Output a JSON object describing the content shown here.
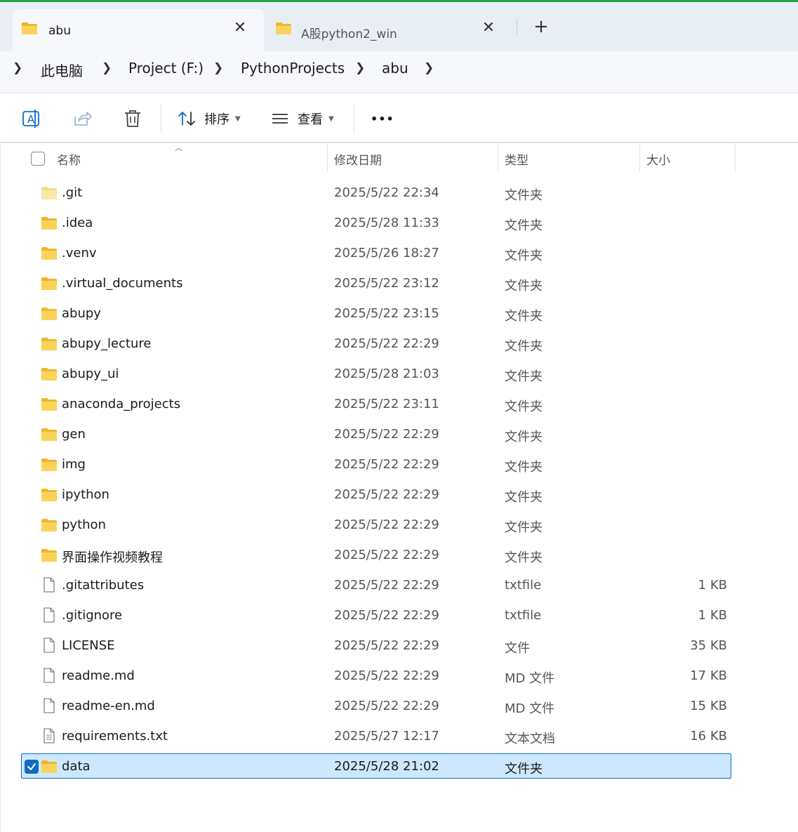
{
  "tabs": [
    {
      "label": "abu",
      "active": true,
      "icon": "folder-icon"
    },
    {
      "label": "A股python2_win",
      "active": false,
      "icon": "folder-icon"
    }
  ],
  "new_tab_label": "+",
  "close_glyph": "✕",
  "breadcrumb": [
    "此电脑",
    "Project (F:)",
    "PythonProjects",
    "abu"
  ],
  "toolbar": {
    "sort_label": "排序",
    "view_label": "查看",
    "more_label": "•••"
  },
  "columns": {
    "name": "名称",
    "date": "修改日期",
    "type": "类型",
    "size": "大小"
  },
  "files": [
    {
      "name": ".git",
      "date": "2025/5/22 22:34",
      "type": "文件夹",
      "size": "",
      "kind": "folder-light"
    },
    {
      "name": ".idea",
      "date": "2025/5/28 11:33",
      "type": "文件夹",
      "size": "",
      "kind": "folder"
    },
    {
      "name": ".venv",
      "date": "2025/5/26 18:27",
      "type": "文件夹",
      "size": "",
      "kind": "folder"
    },
    {
      "name": ".virtual_documents",
      "date": "2025/5/22 23:12",
      "type": "文件夹",
      "size": "",
      "kind": "folder"
    },
    {
      "name": "abupy",
      "date": "2025/5/22 23:15",
      "type": "文件夹",
      "size": "",
      "kind": "folder"
    },
    {
      "name": "abupy_lecture",
      "date": "2025/5/22 22:29",
      "type": "文件夹",
      "size": "",
      "kind": "folder"
    },
    {
      "name": "abupy_ui",
      "date": "2025/5/28 21:03",
      "type": "文件夹",
      "size": "",
      "kind": "folder"
    },
    {
      "name": "anaconda_projects",
      "date": "2025/5/22 23:11",
      "type": "文件夹",
      "size": "",
      "kind": "folder"
    },
    {
      "name": "gen",
      "date": "2025/5/22 22:29",
      "type": "文件夹",
      "size": "",
      "kind": "folder"
    },
    {
      "name": "img",
      "date": "2025/5/22 22:29",
      "type": "文件夹",
      "size": "",
      "kind": "folder"
    },
    {
      "name": "ipython",
      "date": "2025/5/22 22:29",
      "type": "文件夹",
      "size": "",
      "kind": "folder"
    },
    {
      "name": "python",
      "date": "2025/5/22 22:29",
      "type": "文件夹",
      "size": "",
      "kind": "folder"
    },
    {
      "name": "界面操作视频教程",
      "date": "2025/5/22 22:29",
      "type": "文件夹",
      "size": "",
      "kind": "folder"
    },
    {
      "name": ".gitattributes",
      "date": "2025/5/22 22:29",
      "type": "txtfile",
      "size": "1 KB",
      "kind": "file"
    },
    {
      "name": ".gitignore",
      "date": "2025/5/22 22:29",
      "type": "txtfile",
      "size": "1 KB",
      "kind": "file"
    },
    {
      "name": "LICENSE",
      "date": "2025/5/22 22:29",
      "type": "文件",
      "size": "35 KB",
      "kind": "file"
    },
    {
      "name": "readme.md",
      "date": "2025/5/22 22:29",
      "type": "MD 文件",
      "size": "17 KB",
      "kind": "file"
    },
    {
      "name": "readme-en.md",
      "date": "2025/5/22 22:29",
      "type": "MD 文件",
      "size": "15 KB",
      "kind": "file"
    },
    {
      "name": "requirements.txt",
      "date": "2025/5/27 12:17",
      "type": "文本文档",
      "size": "16 KB",
      "kind": "text"
    },
    {
      "name": "data",
      "date": "2025/5/28 21:02",
      "type": "文件夹",
      "size": "",
      "kind": "folder",
      "selected": true
    }
  ],
  "colors": {
    "accent": "#0f6cbd",
    "selection_bg": "#cce8ff",
    "folder": "#f8c93a",
    "tabstrip_top": "#25a249"
  }
}
